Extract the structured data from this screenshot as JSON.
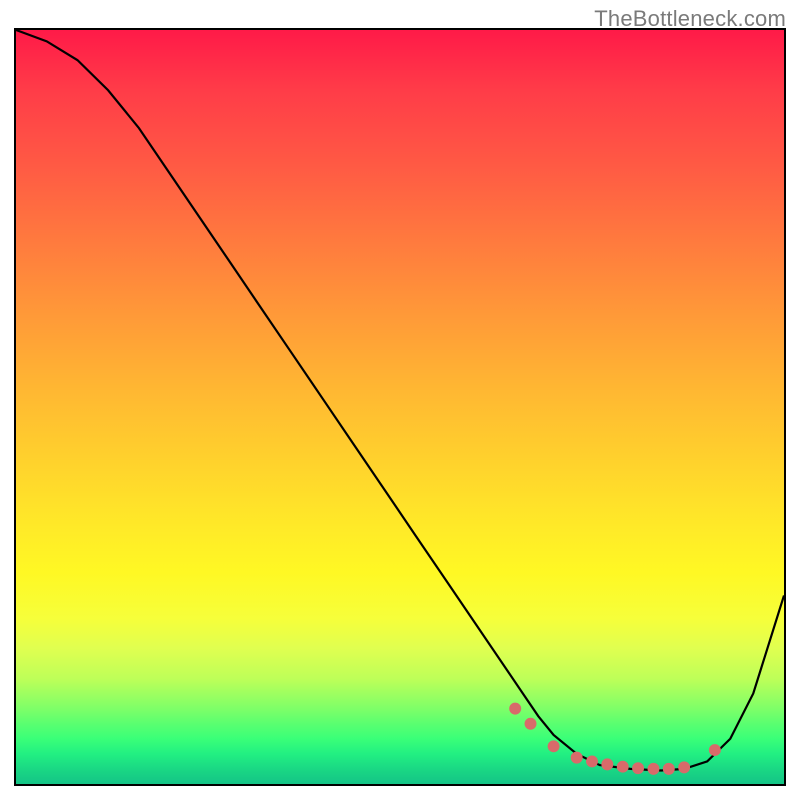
{
  "watermark": "TheBottleneck.com",
  "chart_data": {
    "type": "line",
    "title": "",
    "xlabel": "",
    "ylabel": "",
    "xlim": [
      0,
      100
    ],
    "ylim": [
      0,
      100
    ],
    "series": [
      {
        "name": "curve",
        "x": [
          0,
          4,
          8,
          12,
          16,
          20,
          24,
          28,
          32,
          36,
          40,
          44,
          48,
          52,
          56,
          60,
          64,
          66,
          68,
          70,
          73,
          76,
          80,
          84,
          87,
          90,
          93,
          96,
          100
        ],
        "y": [
          100,
          98.5,
          96,
          92,
          87,
          81,
          75,
          69,
          63,
          57,
          51,
          45,
          39,
          33,
          27,
          21,
          15,
          12,
          9,
          6.5,
          4,
          2.5,
          2,
          1.8,
          2,
          3,
          6,
          12,
          25
        ]
      }
    ],
    "markers": {
      "name": "highlighted-points",
      "x": [
        65,
        67,
        70,
        73,
        75,
        77,
        79,
        81,
        83,
        85,
        87,
        91
      ],
      "y": [
        10,
        8,
        5,
        3.5,
        3,
        2.6,
        2.3,
        2.1,
        2.0,
        2.0,
        2.2,
        4.5
      ]
    }
  }
}
